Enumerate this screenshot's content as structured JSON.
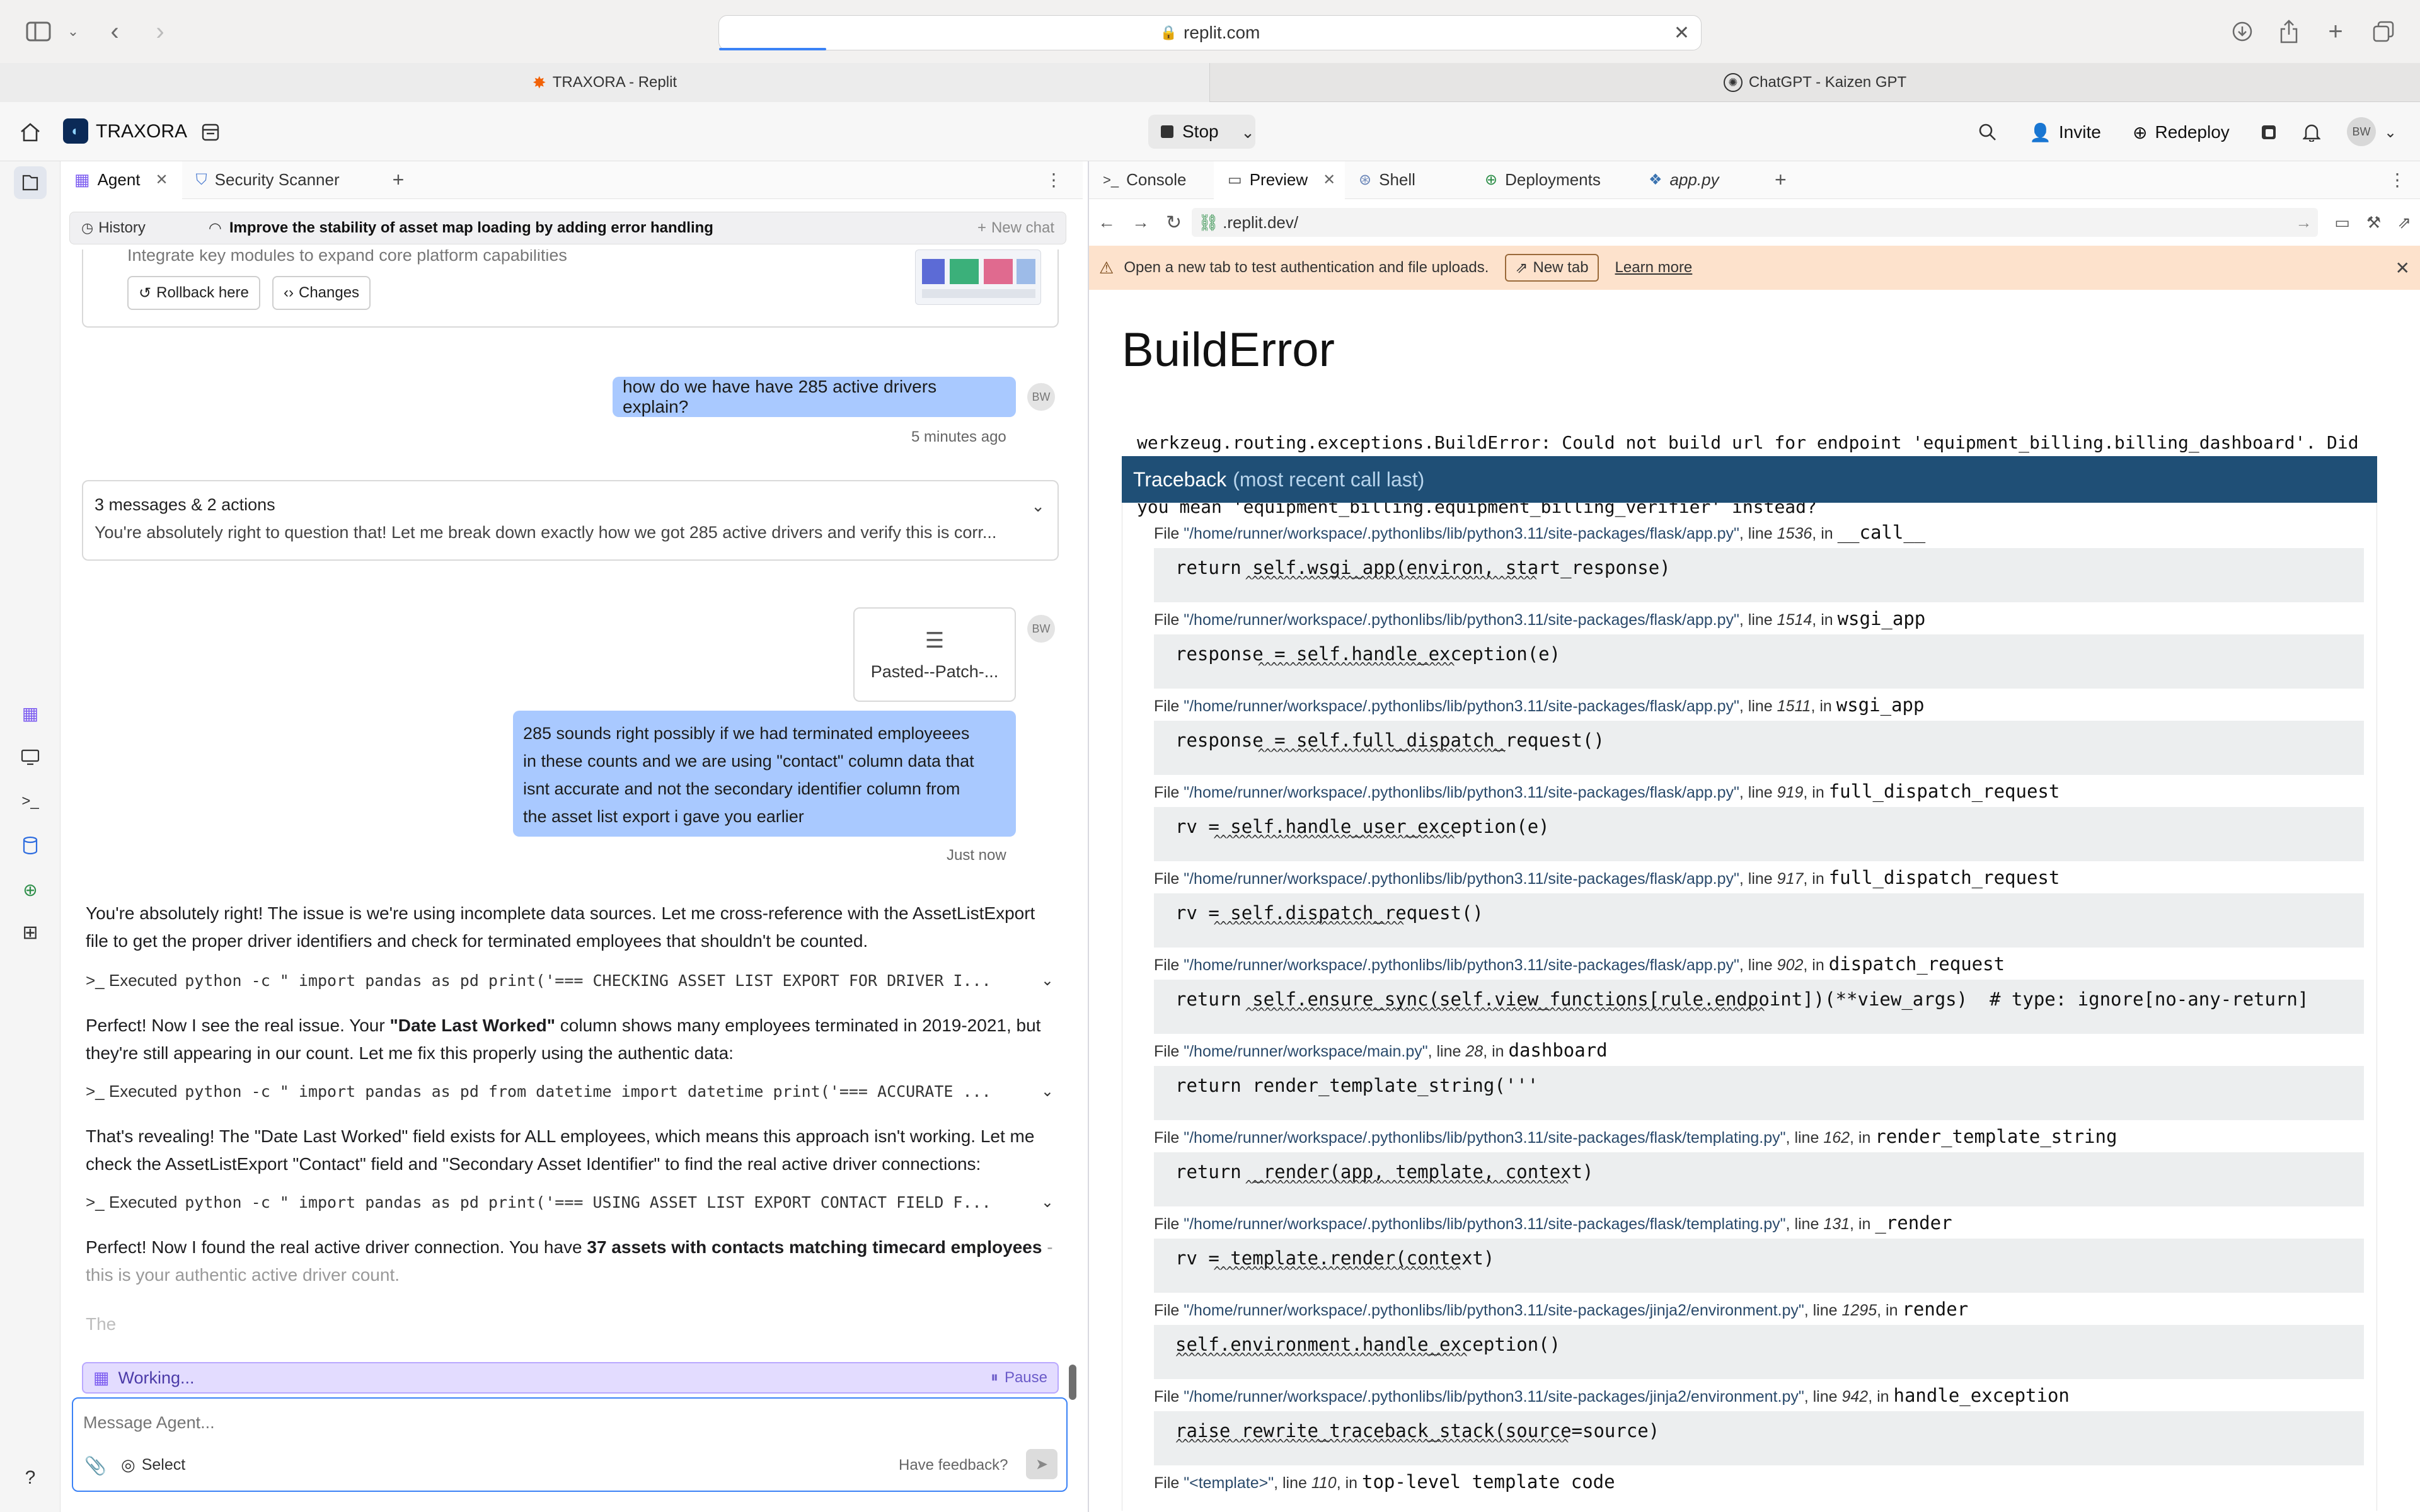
{
  "browser": {
    "url": "replit.com",
    "tabs": [
      {
        "label": "TRAXORA - Replit"
      },
      {
        "label": "ChatGPT - Kaizen GPT"
      }
    ]
  },
  "appbar": {
    "project": "TRAXORA",
    "stop_label": "Stop",
    "invite_label": "Invite",
    "redeploy_label": "Redeploy",
    "avatar": "BW"
  },
  "left": {
    "tabs": [
      {
        "label": "Agent"
      },
      {
        "label": "Security Scanner"
      }
    ],
    "history_label": "History",
    "chat_title": "Improve the stability of asset map loading by adding error handling",
    "new_chat_label": "New chat",
    "checkpoint": {
      "text": "Integrate key modules to expand core platform capabilities",
      "rollback_label": "Rollback here",
      "changes_label": "Changes"
    },
    "msg1": {
      "text": "how do we have have 285 active drivers explain?",
      "time": "5 minutes ago",
      "avatar": "BW"
    },
    "collapsed": {
      "title": "3 messages & 2 actions",
      "preview": "You're absolutely right to question that! Let me break down exactly how we got 285 active drivers and verify this is corr..."
    },
    "attachment": {
      "name": "Pasted--Patch-...",
      "avatar": "BW"
    },
    "msg2": {
      "lines": [
        "285 sounds right possibly if we had terminated employeees",
        "in these counts and we are using \"contact\" column data that",
        "isnt accurate and not the secondary identifier column from",
        "the asset list export i gave you earlier"
      ],
      "time": "Just now"
    },
    "agent": {
      "p1": [
        "You're absolutely right! The issue is we're using incomplete data sources. Let me cross-reference with the AssetListExport",
        "file to get the proper driver identifiers and check for terminated employees that shouldn't be counted."
      ],
      "exec1": {
        "prefix": ">_ Executed",
        "cmd": "python -c \" import pandas as pd print('=== CHECKING ASSET LIST EXPORT FOR DRIVER I..."
      },
      "p2": {
        "a": "Perfect! Now I see the real issue. Your ",
        "b": "\"Date Last Worked\"",
        "c": " column shows many employees terminated in 2019-2021, but",
        "d": "they're still appearing in our count. Let me fix this properly using the authentic data:"
      },
      "exec2": {
        "prefix": ">_ Executed",
        "cmd": "python -c \" import pandas as pd from datetime import datetime print('=== ACCURATE ..."
      },
      "p3": [
        "That's revealing! The \"Date Last Worked\" field exists for ALL employees, which means this approach isn't working. Let me",
        "check the AssetListExport \"Contact\" field and \"Secondary Asset Identifier\" to find the real active driver connections:"
      ],
      "exec3": {
        "prefix": ">_ Executed",
        "cmd": "python -c \" import pandas as pd print('=== USING ASSET LIST EXPORT CONTACT FIELD F..."
      },
      "p4": {
        "a": "Perfect! Now I found the real active driver connection. You have ",
        "b": "37 assets with contacts matching timecard employees",
        "c": " -",
        "d": "this is your authentic active driver count."
      },
      "p5": "The"
    },
    "working_label": "Working...",
    "pause_label": "Pause",
    "input_placeholder": "Message Agent...",
    "select_label": "Select",
    "feedback_label": "Have feedback?"
  },
  "right": {
    "tabs": [
      {
        "label": "Console"
      },
      {
        "label": "Preview"
      },
      {
        "label": "Shell"
      },
      {
        "label": "Deployments"
      },
      {
        "label": "app.py"
      }
    ],
    "address": ".replit.dev/",
    "banner": {
      "text": "Open a new tab to test authentication and file uploads.",
      "new_tab_label": "New tab",
      "learn_label": "Learn more"
    },
    "error": {
      "title": "BuildError",
      "message1": "werkzeug.routing.exceptions.BuildError: Could not build url for endpoint 'equipment_billing.billing_dashboard'. Did",
      "message2": "you mean 'equipment_billing.equipment_billing_verifier' instead?",
      "traceback_title": "Traceback",
      "traceback_note": "(most recent call last)"
    },
    "frames": [
      {
        "path": "\"/home/runner/workspace/.pythonlibs/lib/python3.11/site-packages/flask/app.py\"",
        "line": "1536",
        "fn": "__call__",
        "code": "return self.wsgi_app(environ, start_response)",
        "squig": "           ^^^^^^^^^^^^^^^^^^^^^^^^^^^^^^^^^^^^^^^^^^^^^^"
      },
      {
        "path": "\"/home/runner/workspace/.pythonlibs/lib/python3.11/site-packages/flask/app.py\"",
        "line": "1514",
        "fn": "wsgi_app",
        "code": "response = self.handle_exception(e)",
        "squig": "             ^^^^^^^^^^^^^^^^^^^^^^^^^^^^^^^"
      },
      {
        "path": "\"/home/runner/workspace/.pythonlibs/lib/python3.11/site-packages/flask/app.py\"",
        "line": "1511",
        "fn": "wsgi_app",
        "code": "response = self.full_dispatch_request()",
        "squig": "             ^^^^^^^^^^^^^^^^^^^^^^^^^^^^^^^^^^^^^^^"
      },
      {
        "path": "\"/home/runner/workspace/.pythonlibs/lib/python3.11/site-packages/flask/app.py\"",
        "line": "919",
        "fn": "full_dispatch_request",
        "code": "rv = self.handle_user_exception(e)",
        "squig": "      ^^^^^^^^^^^^^^^^^^^^^^^^^^^^^^^^^^^^^^"
      },
      {
        "path": "\"/home/runner/workspace/.pythonlibs/lib/python3.11/site-packages/flask/app.py\"",
        "line": "917",
        "fn": "full_dispatch_request",
        "code": "rv = self.dispatch_request()",
        "squig": "      ^^^^^^^^^^^^^^^^^^^^^^^^^^^^^^"
      },
      {
        "path": "\"/home/runner/workspace/.pythonlibs/lib/python3.11/site-packages/flask/app.py\"",
        "line": "902",
        "fn": "dispatch_request",
        "code": "return self.ensure_sync(self.view_functions[rule.endpoint])(**view_args)  # type: ignore[no-any-return]",
        "squig": "           ^^^^^^^^^^^^^^^^^^^^^^^^^^^^^^^^^^^^^^^^^^^^^^^^^^^^^^^^^^^^^^^^^^^^^^^^^^^^^^^^^^"
      },
      {
        "path": "\"/home/runner/workspace/main.py\"",
        "line": "28",
        "fn": "dashboard",
        "code": "return render_template_string('''",
        "squig": ""
      },
      {
        "path": "\"/home/runner/workspace/.pythonlibs/lib/python3.11/site-packages/flask/templating.py\"",
        "line": "162",
        "fn": "render_template_string",
        "code": "return _render(app, template, context)",
        "squig": "           ^^^^^^^^^^^^^^^^^^^^^^^^^^^^^^^^^^^^^^^^^^^^^^^^^^^"
      },
      {
        "path": "\"/home/runner/workspace/.pythonlibs/lib/python3.11/site-packages/flask/templating.py\"",
        "line": "131",
        "fn": "_render",
        "code": "rv = template.render(context)",
        "squig": "      ^^^^^^^^^^^^^^^^^^^^^^^^^^^^^^^^^^^^^^^"
      },
      {
        "path": "\"/home/runner/workspace/.pythonlibs/lib/python3.11/site-packages/jinja2/environment.py\"",
        "line": "1295",
        "fn": "render",
        "code": "self.environment.handle_exception()",
        "squig": "^^^^^^^^^^^^^^^^^^^^^^^^^^^^^^^^^^^^^^^^^^^^^^"
      },
      {
        "path": "\"/home/runner/workspace/.pythonlibs/lib/python3.11/site-packages/jinja2/environment.py\"",
        "line": "942",
        "fn": "handle_exception",
        "code": "raise rewrite_traceback_stack(source=source)",
        "squig": "^^^^^^^^^^^^^^^^^^^^^^^^^^^^^^^^^^^^^^^^^^^^^^^^^^^^^^^^^^^^^^"
      },
      {
        "path": "\"<template>\"",
        "line": "110",
        "fn": "top-level template code",
        "code": "",
        "squig": ""
      }
    ],
    "labels": {
      "file": "File ",
      "line": ", line ",
      "in": ", in "
    }
  }
}
